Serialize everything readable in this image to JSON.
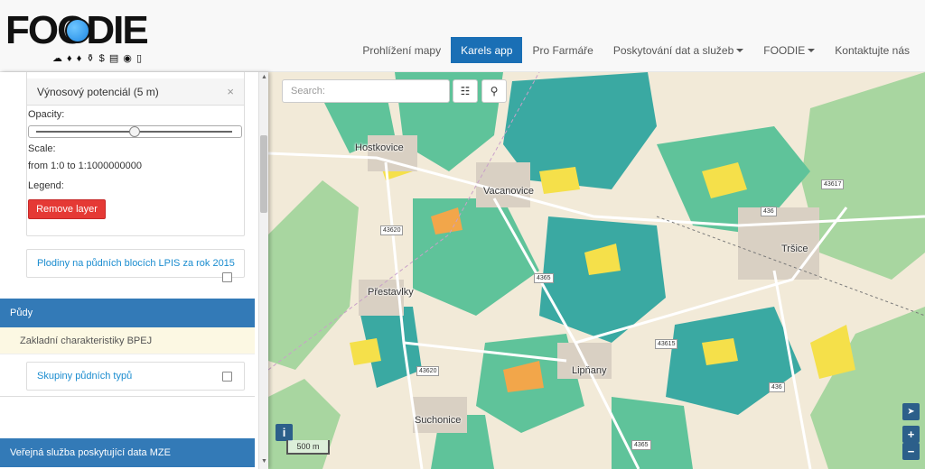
{
  "brand": {
    "logo_text": "FOODIE",
    "logo_icons": "☁ ♦ ♦ ⚱ $ ▤ ◉ ▯"
  },
  "nav": {
    "items": [
      {
        "label": "Prohlížení mapy",
        "active": false,
        "dropdown": false
      },
      {
        "label": "Karels app",
        "active": true,
        "dropdown": false
      },
      {
        "label": "Pro Farmáře",
        "active": false,
        "dropdown": false
      },
      {
        "label": "Poskytování dat a služeb",
        "active": false,
        "dropdown": true
      },
      {
        "label": "FOODIE",
        "active": false,
        "dropdown": true
      },
      {
        "label": "Kontaktujte nás",
        "active": false,
        "dropdown": false
      }
    ]
  },
  "sidebar": {
    "layer": {
      "title": "Výnosový potenciál (5 m)",
      "close_symbol": "×",
      "opacity_label": "Opacity:",
      "opacity_value": 0.5,
      "scale_label": "Scale:",
      "scale_value": "from 1:0 to 1:1000000000",
      "legend_label": "Legend:",
      "remove_label": "Remove layer"
    },
    "layer_link_1": "Plodiny na půdních blocích LPIS za rok 2015",
    "group_soils": "Půdy",
    "sub_bpej": "Zakladní charakteristiky BPEJ",
    "layer_link_2": "Skupiny půdních typů",
    "group_mze": "Veřejná služba poskytující data MZE"
  },
  "map": {
    "search_placeholder": "Search:",
    "info_symbol": "i",
    "locate_symbol": "➤",
    "zoom_in": "+",
    "zoom_out": "−",
    "scale_text": "500 m",
    "places": [
      "Hostkovice",
      "Vacanovice",
      "Přestavlky",
      "Lipňany",
      "Suchonice",
      "Tršice"
    ],
    "road_numbers": [
      "43620",
      "4365",
      "43620",
      "43615",
      "436",
      "43617",
      "436",
      "4365"
    ],
    "colors": {
      "base": "#f2ead8",
      "forest": "#a8d6a0",
      "field_green": "#5fc39a",
      "field_teal": "#3aa9a2",
      "yellow": "#f5e04a",
      "orange": "#f2a64a"
    }
  }
}
